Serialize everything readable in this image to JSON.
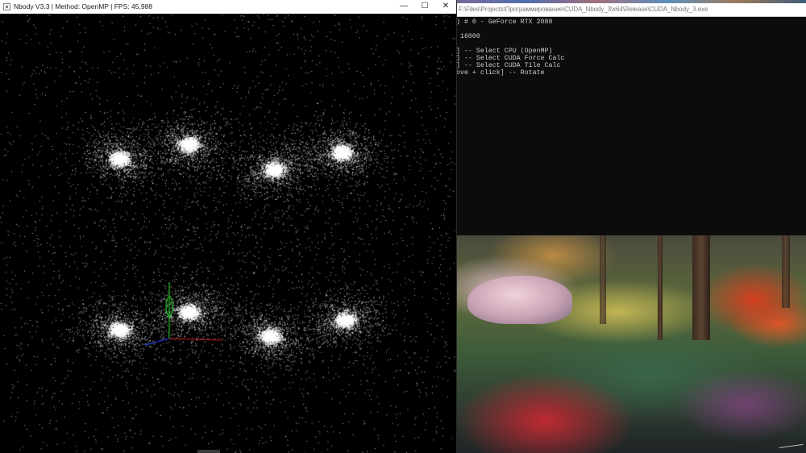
{
  "nbody_window": {
    "title": "Nbody V3.3 | Method: OpenMP | FPS: 45,988",
    "minimize_glyph": "—",
    "maximize_glyph": "☐",
    "close_glyph": "✕",
    "icon": "app-window-icon"
  },
  "simulation": {
    "galaxy_clusters": 8,
    "axis_colors": {
      "x": "#d02020",
      "y": "#20c020",
      "z": "#2040ff"
    }
  },
  "console_window": {
    "title": "F:\\Files\\Projects\\Программирование\\CUDA_Nbody_3\\x64\\Release\\CUDA_Nbody_3.exe",
    "lines": [
      ") # 0 - GeForce RTX 2080",
      "",
      " 16000",
      "",
      "] -- Select CPU (OpenMP)",
      "] -- Select CUDA Force Calc",
      "] -- Select CUDA Tile Calc",
      "ove + click] -- Rotate"
    ]
  },
  "desktop": {
    "wallpaper": "forest-painting"
  }
}
